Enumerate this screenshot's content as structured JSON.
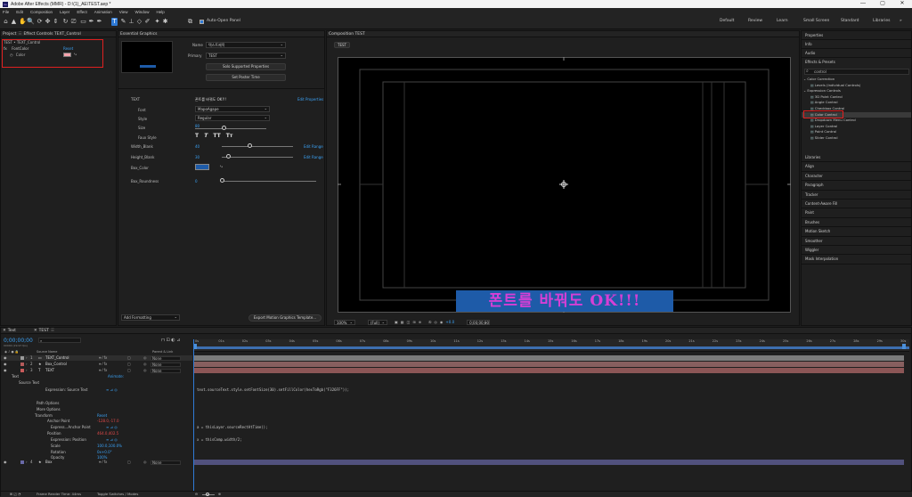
{
  "titlebar": {
    "title": "Adobe After Effects (MMR) - D:\\(1)_AE\\TEST.aep *"
  },
  "menu": [
    "File",
    "Edit",
    "Composition",
    "Layer",
    "Effect",
    "Animation",
    "View",
    "Window",
    "Help"
  ],
  "toolbar": {
    "auto_open_panel": "Auto-Open Panel",
    "workspaces": [
      "Default",
      "Review",
      "Learn",
      "Small Screen",
      "Standard",
      "Libraries"
    ]
  },
  "project": {
    "tab": "Project",
    "breadcrumb": "TEST • TEXT_Control",
    "fx_label": "fx",
    "effect_name": "FontColor",
    "reset": "Reset",
    "prop": "Color"
  },
  "effect_controls": {
    "tab": "Effect Controls TEXT_Control"
  },
  "eg": {
    "tab": "Essential Graphics",
    "name_label": "Name",
    "name_value": "텍스트제목",
    "primary_label": "Primary",
    "primary_value": "TEST",
    "solo_btn": "Solo Supported Properties",
    "poster_btn": "Set Poster Time",
    "text_label": "TEXT",
    "text_value": "폰트를 바꿔도 OK!!!",
    "edit_props": "Edit Properties",
    "font_label": "Font",
    "font_value": "MapoAgape",
    "style_label": "Style",
    "style_value": "Regular",
    "size_label": "Size",
    "size_value": "80",
    "faux_label": "Faux Style",
    "faux_styles": [
      "T",
      "T",
      "TT",
      "Tт"
    ],
    "width_label": "Width_Blank",
    "width_value": "40",
    "height_label": "Height_Blank",
    "height_value": "30",
    "edit_range": "Edit Range",
    "box_color_label": "Box_Color",
    "box_color": "#1e5ba8",
    "roundness_label": "Box_Roundness",
    "roundness_value": "0",
    "add_formatting": "Add Formatting",
    "export_btn": "Export Motion Graphics Template..."
  },
  "comp": {
    "tab": "Composition TEST",
    "comp_tab": "TEST",
    "text": "폰트를 바꿔도 OK!!!",
    "text_color": "#d63fd6",
    "box_color": "#1e5ba8",
    "zoom": "100%",
    "res": "(Full)",
    "exposure": "+0.0",
    "timecode": "0;00;00;00"
  },
  "right": {
    "panels": [
      "Properties",
      "Info",
      "Audio"
    ],
    "effects_presets": "Effects & Presets",
    "search": "control",
    "tree": [
      "Color Correction",
      "Levels (Individual Controls)",
      "Expression Controls",
      "3D Point Control",
      "Angle Control",
      "Checkbox Control",
      "Color Control",
      "Dropdown Menu Control",
      "Layer Control",
      "Point Control",
      "Slider Control"
    ],
    "more": [
      "Libraries",
      "Align",
      "Character",
      "Paragraph",
      "Tracker",
      "Content-Aware Fill",
      "Paint",
      "Brushes",
      "Motion Sketch",
      "Smoother",
      "Wiggler",
      "Mask Interpolation"
    ]
  },
  "timeline": {
    "tab_text": "Text",
    "tab_test": "TEST",
    "timecode": "0;00;00;00",
    "fps": "00000 (29.97 fps)",
    "header": {
      "source": "Source Name",
      "parent": "Parent & Link"
    },
    "layers": [
      {
        "num": "1",
        "name": "TEXT_Control",
        "parent": "None",
        "color": "#9a9a9a"
      },
      {
        "num": "2",
        "name": "Box_Control",
        "parent": "None",
        "color": "#b55a5a"
      },
      {
        "num": "3",
        "name": "TEXT",
        "parent": "None",
        "color": "#c85a5a"
      },
      {
        "num": "4",
        "name": "Box",
        "parent": "None",
        "color": "#6a6aa8"
      }
    ],
    "props": {
      "text": "Text",
      "animate": "Animate:",
      "source_text": "Source Text",
      "expression_source": "Expression: Source Text",
      "path_options": "Path Options",
      "more_options": "More Options",
      "transform": "Transform",
      "reset": "Reset",
      "anchor": "Anchor Point",
      "anchor_val": "-128.0,-17.0",
      "expr_anchor": "Express...Anchor Point",
      "position": "Position",
      "position_val": "464.0,402.5",
      "expr_position": "Expression: Position",
      "scale": "Scale",
      "scale_val": "100.0,100.0%",
      "rotation": "Rotation",
      "rotation_val": "0x+0.0°",
      "opacity": "Opacity",
      "opacity_val": "100%"
    },
    "ruler": [
      "0s",
      "01s",
      "02s",
      "03s",
      "04s",
      "05s",
      "06s",
      "07s",
      "08s",
      "09s",
      "10s",
      "11s",
      "12s",
      "13s",
      "14s",
      "15s",
      "16s",
      "17s",
      "18s",
      "19s",
      "20s",
      "21s",
      "22s",
      "23s",
      "24s",
      "25s",
      "26s",
      "27s",
      "28s",
      "29s",
      "30s"
    ],
    "code": [
      "text.sourceText.style.setFontSize(30).setFillColor(hexToRgb(\"F326FF\"));",
      "a = thisLayer.sourceRectAtTime();",
      "x = thisComp.width/2;"
    ],
    "footer": {
      "render_time": "Frame Render Time: 44ms",
      "toggle": "Toggle Switches / Modes"
    }
  }
}
